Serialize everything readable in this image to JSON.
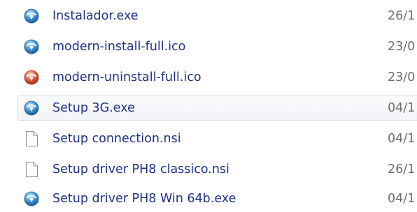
{
  "file_list": {
    "rows": [
      {
        "name": "Instalador.exe",
        "date": "26/1",
        "icon": "installer-exe-icon",
        "icon_color": "#3a8fd0"
      },
      {
        "name": "modern-install-full.ico",
        "date": "23/0",
        "icon": "install-ico-icon",
        "icon_color": "#3a8fd0"
      },
      {
        "name": "modern-uninstall-full.ico",
        "date": "23/0",
        "icon": "uninstall-ico-icon",
        "icon_color": "#e0553a"
      },
      {
        "name": "Setup 3G.exe",
        "date": "04/1",
        "icon": "installer-exe-icon",
        "icon_color": "#3a8fd0",
        "hovered": true
      },
      {
        "name": "Setup connection.nsi",
        "date": "04/1",
        "icon": "blank-document-icon"
      },
      {
        "name": "Setup driver PH8 classico.nsi",
        "date": "26/1",
        "icon": "blank-document-icon"
      },
      {
        "name": "Setup driver PH8 Win 64b.exe",
        "date": "04/1",
        "icon": "installer-exe-icon",
        "icon_color": "#3a8fd0"
      }
    ]
  },
  "colors": {
    "name_text": "#1e3287",
    "date_text": "#6d6d6d",
    "hover_border": "#d9d9d9"
  }
}
